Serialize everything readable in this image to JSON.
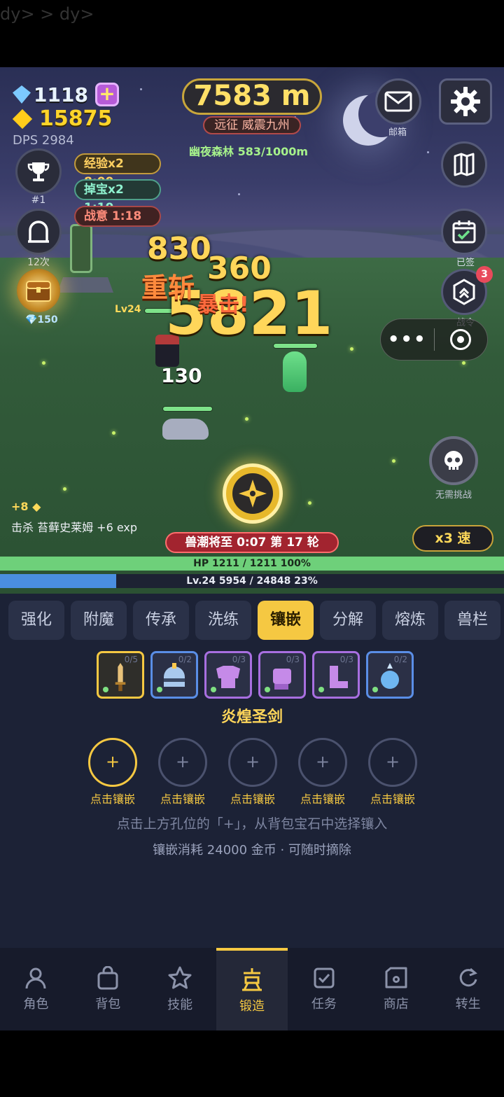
{
  "debug_text": "dy> > dy>",
  "hud": {
    "gems": "1118",
    "gold": "15875",
    "dps": "DPS 2984",
    "distance": "7583 m",
    "expedition": "远征 威震九州",
    "stage": "幽夜森林  583/1000m"
  },
  "left_buttons": {
    "rank_label": "#1",
    "portal_label": "12次",
    "chest_label": "💎150"
  },
  "buffs": {
    "exp": "经验x2 8:00",
    "drop": "掉宝x2 1:10",
    "war": "战意 1:18"
  },
  "right_buttons": {
    "mail_label": "邮箱",
    "checkin_label": "已签",
    "pass_label": "战令",
    "pass_badge": "3",
    "skull_label": "无需挑战"
  },
  "combat": {
    "damage_big": "5821",
    "damage_830": "830",
    "damage_360": "360",
    "slash": "重斩",
    "crit": "暴击!",
    "damage_130": "130",
    "hero_level": "Lv24"
  },
  "log": {
    "gold_gain": "+8 ◆",
    "kill": "击杀 苔藓史莱姆  +6 exp"
  },
  "wave": "兽潮将至 0:07    第 17 轮",
  "speed": "x3 速",
  "capsule": {
    "more": "•••"
  },
  "bars": {
    "hp_text": "HP  1211 / 1211   100%",
    "hp_ratio": 1.0,
    "xp_text": "Lv.24    5954 / 24848    23%",
    "xp_ratio": 0.23
  },
  "forge": {
    "tabs": [
      "强化",
      "附魔",
      "传承",
      "洗练",
      "镶嵌",
      "分解",
      "熔炼",
      "兽栏"
    ],
    "active_tab": "镶嵌",
    "slots": [
      {
        "icon": "sword-icon",
        "count": "0/5"
      },
      {
        "icon": "helmet-icon",
        "count": "0/2"
      },
      {
        "icon": "armor-icon",
        "count": "0/3"
      },
      {
        "icon": "glove-icon",
        "count": "0/3"
      },
      {
        "icon": "boot-icon",
        "count": "0/3"
      },
      {
        "icon": "orb-icon",
        "count": "0/2"
      }
    ],
    "item_name": "炎煌圣剑",
    "socket_label": "点击镶嵌",
    "socket_plus": "+",
    "hint1": "点击上方孔位的「+」，从背包宝石中选择镶入",
    "hint2": "镶嵌消耗 24000 金币 · 可随时摘除"
  },
  "nav": {
    "items": [
      "角色",
      "背包",
      "技能",
      "锻造",
      "任务",
      "商店",
      "转生"
    ],
    "active": "锻造"
  },
  "colors": {
    "accent": "#f5c842",
    "panel": "#1c2236",
    "hp": "#6ed07a",
    "xp": "#4a8ee0"
  }
}
